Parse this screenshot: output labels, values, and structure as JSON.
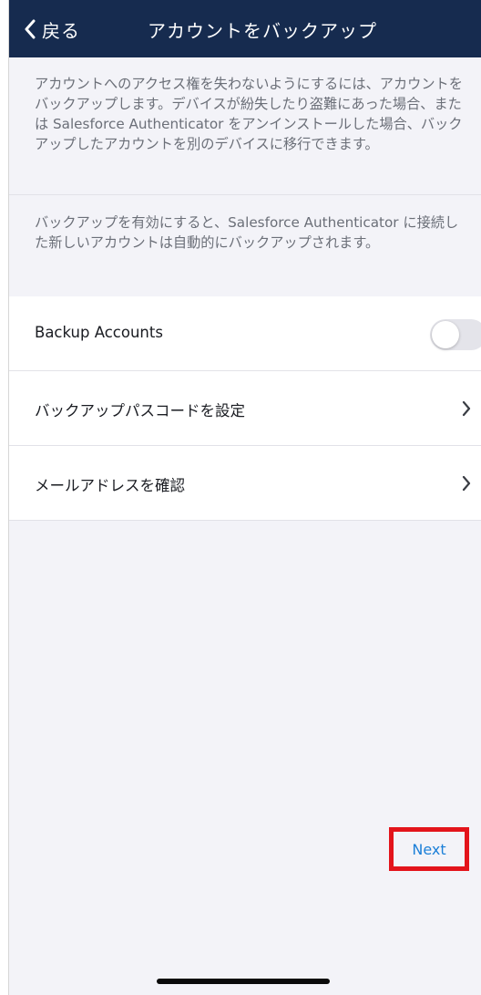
{
  "header": {
    "back_label": "戻る",
    "title": "アカウントをバックアップ"
  },
  "descriptions": {
    "first": "アカウントへのアクセス権を失わないようにするには、アカウントをバックアップします。デバイスが紛失したり盗難にあった場合、または Salesforce Authenticator をアンインストールした場合、バックアップしたアカウントを別のデバイスに移行できます。",
    "second": "バックアップを有効にすると、Salesforce Authenticator に接続した新しいアカウントは自動的にバックアップされます。"
  },
  "rows": {
    "backup_label": "Backup Accounts",
    "backup_enabled": false,
    "passcode_label": "バックアップパスコードを設定",
    "email_label": "メールアドレスを確認"
  },
  "actions": {
    "next_label": "Next"
  },
  "colors": {
    "header_bg": "#162b4f",
    "accent": "#1b7fd8",
    "highlight": "#e3141b"
  },
  "icons": [
    "chevron-left-icon",
    "chevron-right-icon"
  ]
}
